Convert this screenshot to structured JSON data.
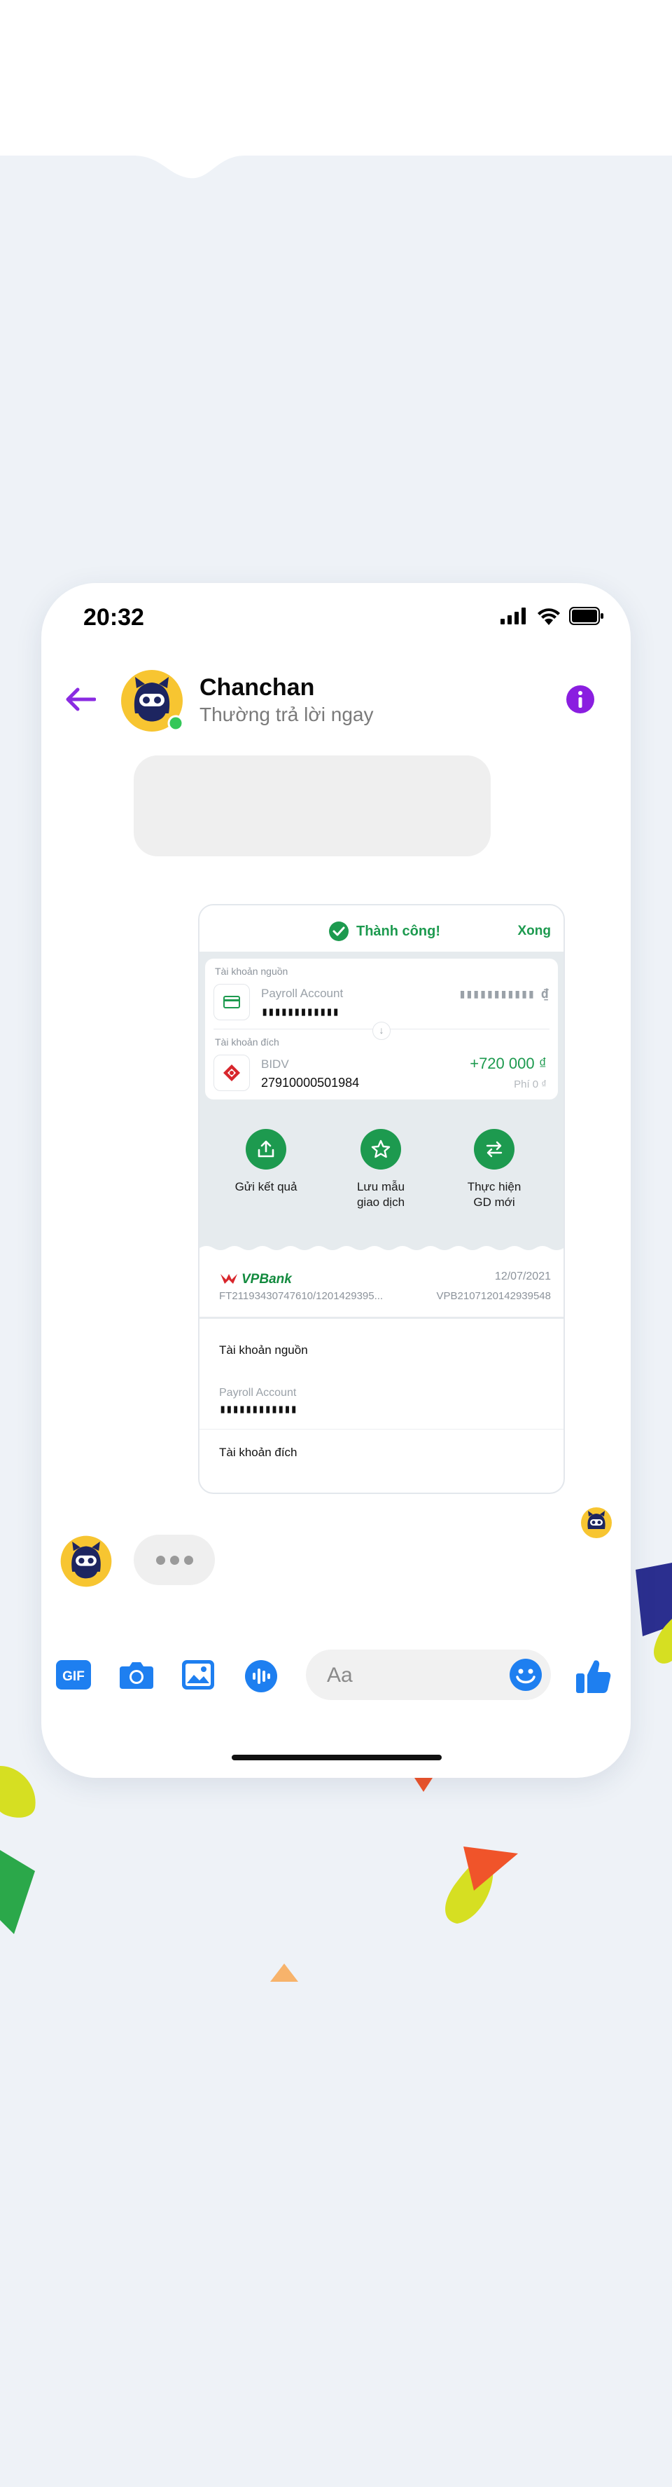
{
  "status_bar": {
    "time": "20:32"
  },
  "header": {
    "contact_name": "Chanchan",
    "contact_status": "Thường trả lời ngay"
  },
  "receipt": {
    "success_text": "Thành công!",
    "done_label": "Xong",
    "source_label": "Tài khoản nguồn",
    "source_account_name": "Payroll Account",
    "source_account_number": "▮▮▮▮▮▮▮▮▮▮▮▮",
    "source_balance": "▮▮▮▮▮▮▮▮▮▮▮ ₫",
    "dest_label": "Tài khoản đích",
    "dest_bank": "BIDV",
    "dest_account_number": "27910000501984",
    "amount": "+720 000 ₫",
    "fee": "Phí 0 ₫",
    "actions": [
      {
        "label": "Gửi kết quả",
        "icon": "share-icon"
      },
      {
        "label": "Lưu mẫu\ngiao dịch",
        "icon": "star-icon"
      },
      {
        "label": "Thực hiện\nGD mới",
        "icon": "swap-icon"
      }
    ],
    "bank_name": "VPBank",
    "date": "12/07/2021",
    "ref_ft": "FT21193430747610/1201429395...",
    "ref_vpb": "VPB2107120142939548",
    "detail_source_label": "Tài khoản nguồn",
    "detail_source_name": "Payroll Account",
    "detail_source_number": "▮▮▮▮▮▮▮▮▮▮▮▮",
    "detail_dest_label": "Tài khoản đích"
  },
  "composer": {
    "gif_label": "GIF",
    "placeholder": "Aa"
  },
  "colors": {
    "accent_purple": "#8a2be2",
    "messenger_blue": "#1e7ff0",
    "success_green": "#1d9a4f",
    "background": "#eef2f7"
  }
}
